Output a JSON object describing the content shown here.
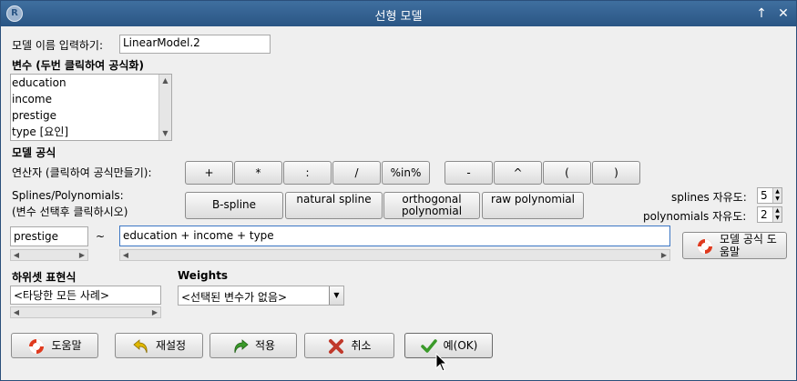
{
  "window": {
    "title": "선형 모델"
  },
  "model_name": {
    "label": "모델 이름 입력하기:",
    "value": "LinearModel.2"
  },
  "variables": {
    "heading": "변수 (두번 클릭하여 공식화)",
    "items": [
      "education",
      "income",
      "prestige",
      "type [요인]"
    ]
  },
  "formula": {
    "heading": "모델 공식",
    "operators_label": "연산자 (클릭하여 공식만들기):",
    "operators": [
      "+",
      "*",
      ":",
      "/",
      "%in%",
      "-",
      "^",
      "(",
      ")"
    ],
    "splines_label_1": "Splines/Polynomials:",
    "splines_label_2": "(변수 선택후 클릭하시오)",
    "spline_buttons": [
      "B-spline",
      "natural spline",
      "orthogonal polynomial",
      "raw polynomial"
    ],
    "splines_df_label": "splines 자유도:",
    "splines_df_value": "5",
    "poly_df_label": "polynomials 자유도:",
    "poly_df_value": "2",
    "lhs_value": "prestige",
    "tilde": "~",
    "rhs_value": "education + income + type",
    "help_button": "모델 공식 도움말"
  },
  "subset": {
    "heading": "하위셋 표현식",
    "value": "<타당한 모든 사례>"
  },
  "weights": {
    "heading": "Weights",
    "value": "<선택된 변수가 없음>"
  },
  "actions": {
    "help": "도움말",
    "reset": "재설정",
    "apply": "적용",
    "cancel": "취소",
    "ok": "예(OK)"
  },
  "colors": {
    "titlebar": "#2a5584",
    "ok_check": "#3a9a2a",
    "cancel_x": "#c0392b",
    "help_ring": "#e03a1e"
  }
}
